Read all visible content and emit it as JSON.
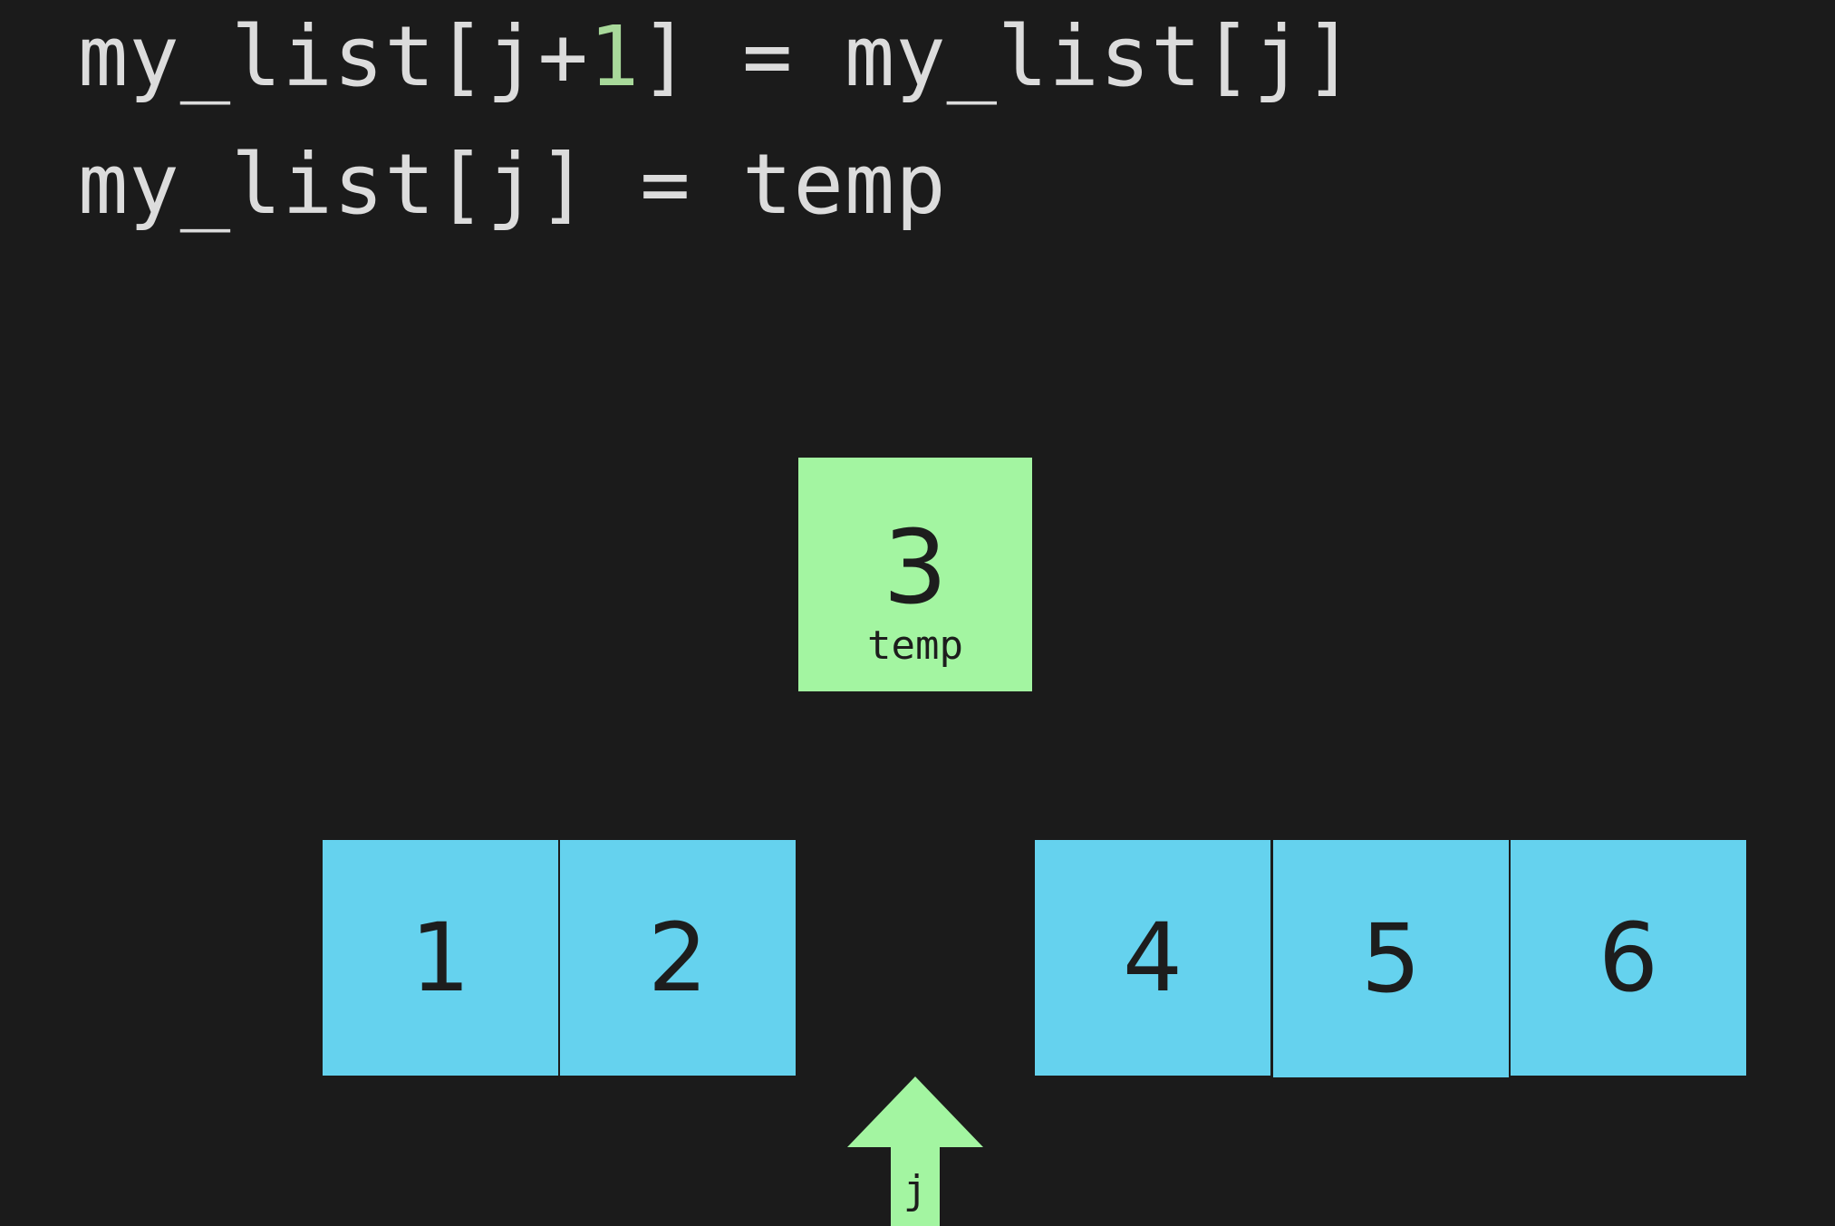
{
  "code": {
    "line1": {
      "before": "my_list[j+",
      "number": "1",
      "after": "] = my_list[j]"
    },
    "line2": "my_list[j] = temp"
  },
  "temp": {
    "value": "3",
    "label": "temp"
  },
  "list_cells": [
    "1",
    "2",
    "4",
    "5",
    "6"
  ],
  "pointer": {
    "label": "j"
  },
  "colors": {
    "background": "#1b1b1b",
    "code_text": "#dcdcdc",
    "code_number": "#a8d99a",
    "list_cell": "#65d2ee",
    "temp_cell": "#a3f5a1",
    "pointer": "#a3f5a1"
  }
}
